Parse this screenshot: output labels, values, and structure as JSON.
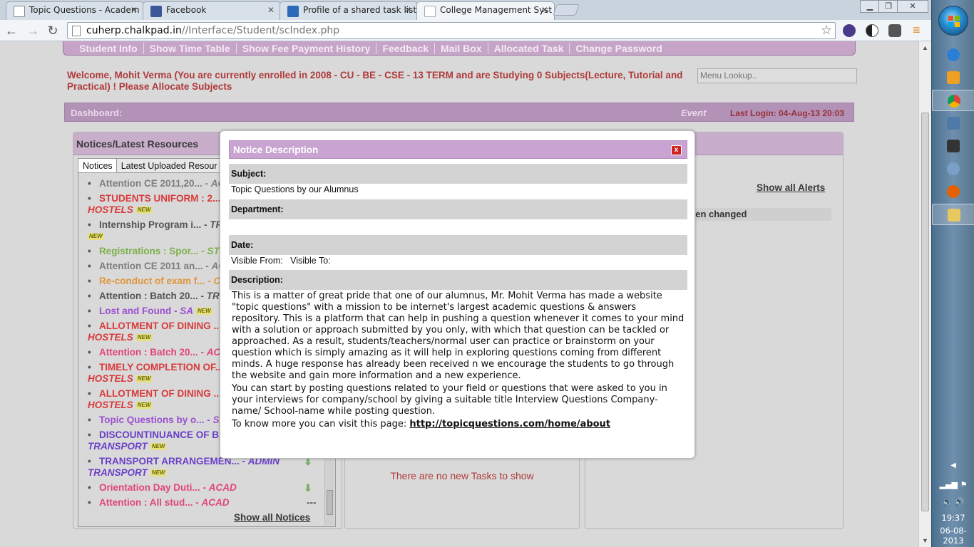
{
  "browser": {
    "tabs": [
      {
        "title": "Topic Questions - Academ",
        "active": false
      },
      {
        "title": "Facebook",
        "active": false
      },
      {
        "title": "Profile of a shared task list",
        "active": false
      },
      {
        "title": "College Management Syst",
        "active": true
      }
    ],
    "url_host": "cuherp.chalkpad.in",
    "url_path": "//Interface/Student/scIndex.php"
  },
  "topnav": {
    "items": [
      "Student Info",
      "Show Time Table",
      "Show Fee Payment History",
      "Feedback",
      "Mail Box",
      "Allocated Task",
      "Change Password"
    ]
  },
  "welcome_text": "Welcome, Mohit Verma (You are currently enrolled in 2008 - CU - BE - CSE - 13 TERM and are Studying 0 Subjects(Lecture, Tutorial and Practical) ! Please Allocate Subjects",
  "menu_lookup_placeholder": "Menu Lookup..",
  "dashboard": {
    "label": "Dashboard:",
    "event_label": "Event",
    "last_login": "Last Login: 04-Aug-13 20:03"
  },
  "notices_panel": {
    "title": "Notices/Latest Resources",
    "tabs": [
      "Notices",
      "Latest Uploaded Resour"
    ],
    "items": [
      {
        "text": "Attention CE 2011,20...",
        "cat": "ACA",
        "color": "#7d7d7d",
        "cont": "",
        "badge": false
      },
      {
        "text": "STUDENTS UNIFORM : 2...",
        "cat": "",
        "color": "#d93a3a",
        "cont": "HOSTELS",
        "badge": true
      },
      {
        "text": "Internship Program i...",
        "cat": "TR",
        "color": "#555555",
        "cont": "",
        "badge": true
      },
      {
        "text": "Registrations : Spor...",
        "cat": "ST",
        "color": "#7bb04a",
        "cont": "",
        "badge": false
      },
      {
        "text": "Attention CE 2011 an...",
        "cat": "AC",
        "color": "#7d7d7d",
        "cont": "",
        "badge": false
      },
      {
        "text": "Re-conduct of exam f...",
        "cat": "C",
        "color": "#e0953a",
        "cont": "",
        "badge": false
      },
      {
        "text": "Attention : Batch 20...",
        "cat": "TRA",
        "color": "#555555",
        "cont": "",
        "badge": false
      },
      {
        "text": "Lost and Found",
        "cat": "SA",
        "color": "#9b4fd0",
        "cont": "",
        "badge": true
      },
      {
        "text": "ALLOTMENT OF DINING ...",
        "cat": "",
        "color": "#d93a3a",
        "cont": "HOSTELS",
        "badge": true
      },
      {
        "text": "Attention : Batch 20...",
        "cat": "ACA",
        "color": "#e0457a",
        "cont": "",
        "badge": false
      },
      {
        "text": "TIMELY COMPLETION OF...",
        "cat": "",
        "color": "#d93a3a",
        "cont": "HOSTELS",
        "badge": true
      },
      {
        "text": "ALLOTMENT OF DINING ...",
        "cat": "",
        "color": "#d93a3a",
        "cont": "HOSTELS",
        "badge": true
      },
      {
        "text": "Topic Questions by o...",
        "cat": "SA",
        "color": "#9b4fd0",
        "cont": "",
        "badge": false
      },
      {
        "text": "DISCOUNTINUANCE OF B...",
        "cat": "",
        "color": "#6a3fc8",
        "cont": "TRANSPORT",
        "badge": true
      },
      {
        "text": "TRANSPORT ARRANGEMEN...",
        "cat": "ADMIN",
        "color": "#6a3fc8",
        "cont": "TRANSPORT",
        "badge": true
      },
      {
        "text": "Orientation Day Duti...",
        "cat": "ACAD",
        "color": "#e0457a",
        "cont": "",
        "badge": false
      },
      {
        "text": "Attention : All stud...",
        "cat": "ACAD",
        "color": "#e0457a",
        "cont": "",
        "badge": false
      }
    ],
    "dash_symbol": "---",
    "show_all": "Show all Notices"
  },
  "tasks_panel": {
    "empty_text": "There are no new Tasks to show"
  },
  "alerts_panel": {
    "row_text": "een changed",
    "show_all": "Show all Alerts"
  },
  "modal": {
    "title": "Notice Description",
    "close": "x",
    "subject_label": "Subject:",
    "subject_value": "Topic Questions by our Alumnus",
    "department_label": "Department:",
    "department_value": "",
    "date_label": "Date:",
    "visible_from": "Visible From:",
    "visible_to": "Visible To:",
    "description_label": "Description:",
    "description_p1": "This is a matter of great pride that one of our alumnus, Mr. Mohit Verma has made a website \"topic questions\" with a mission to be internet's largest academic questions & answers repository. This is a platform that can help in pushing a question whenever it comes to your mind with a solution or approach submitted by you only, with which that question can be tackled or approached. As a result, students/teachers/normal user can practice or brainstorm on your question which is simply amazing as it will help in exploring questions coming from different minds. A huge response has already been received n we encourage the students to go through the website and gain more information and a new experience.",
    "description_p2": "You can start by posting questions related to your field or questions that were asked to you in your interviews for company/school by giving a suitable title Interview Questions Company-name/ School-name while posting question.",
    "description_p3_prefix": "To know more you can visit this page: ",
    "description_link": "http://topicquestions.com/home/about"
  },
  "taskbar": {
    "time": "19:37",
    "date": "06-08-2013"
  },
  "colors": {
    "modal_title_bg": "#c9a3d1",
    "dash_bar": "#b292b6",
    "welcome": "#b03a3a"
  }
}
